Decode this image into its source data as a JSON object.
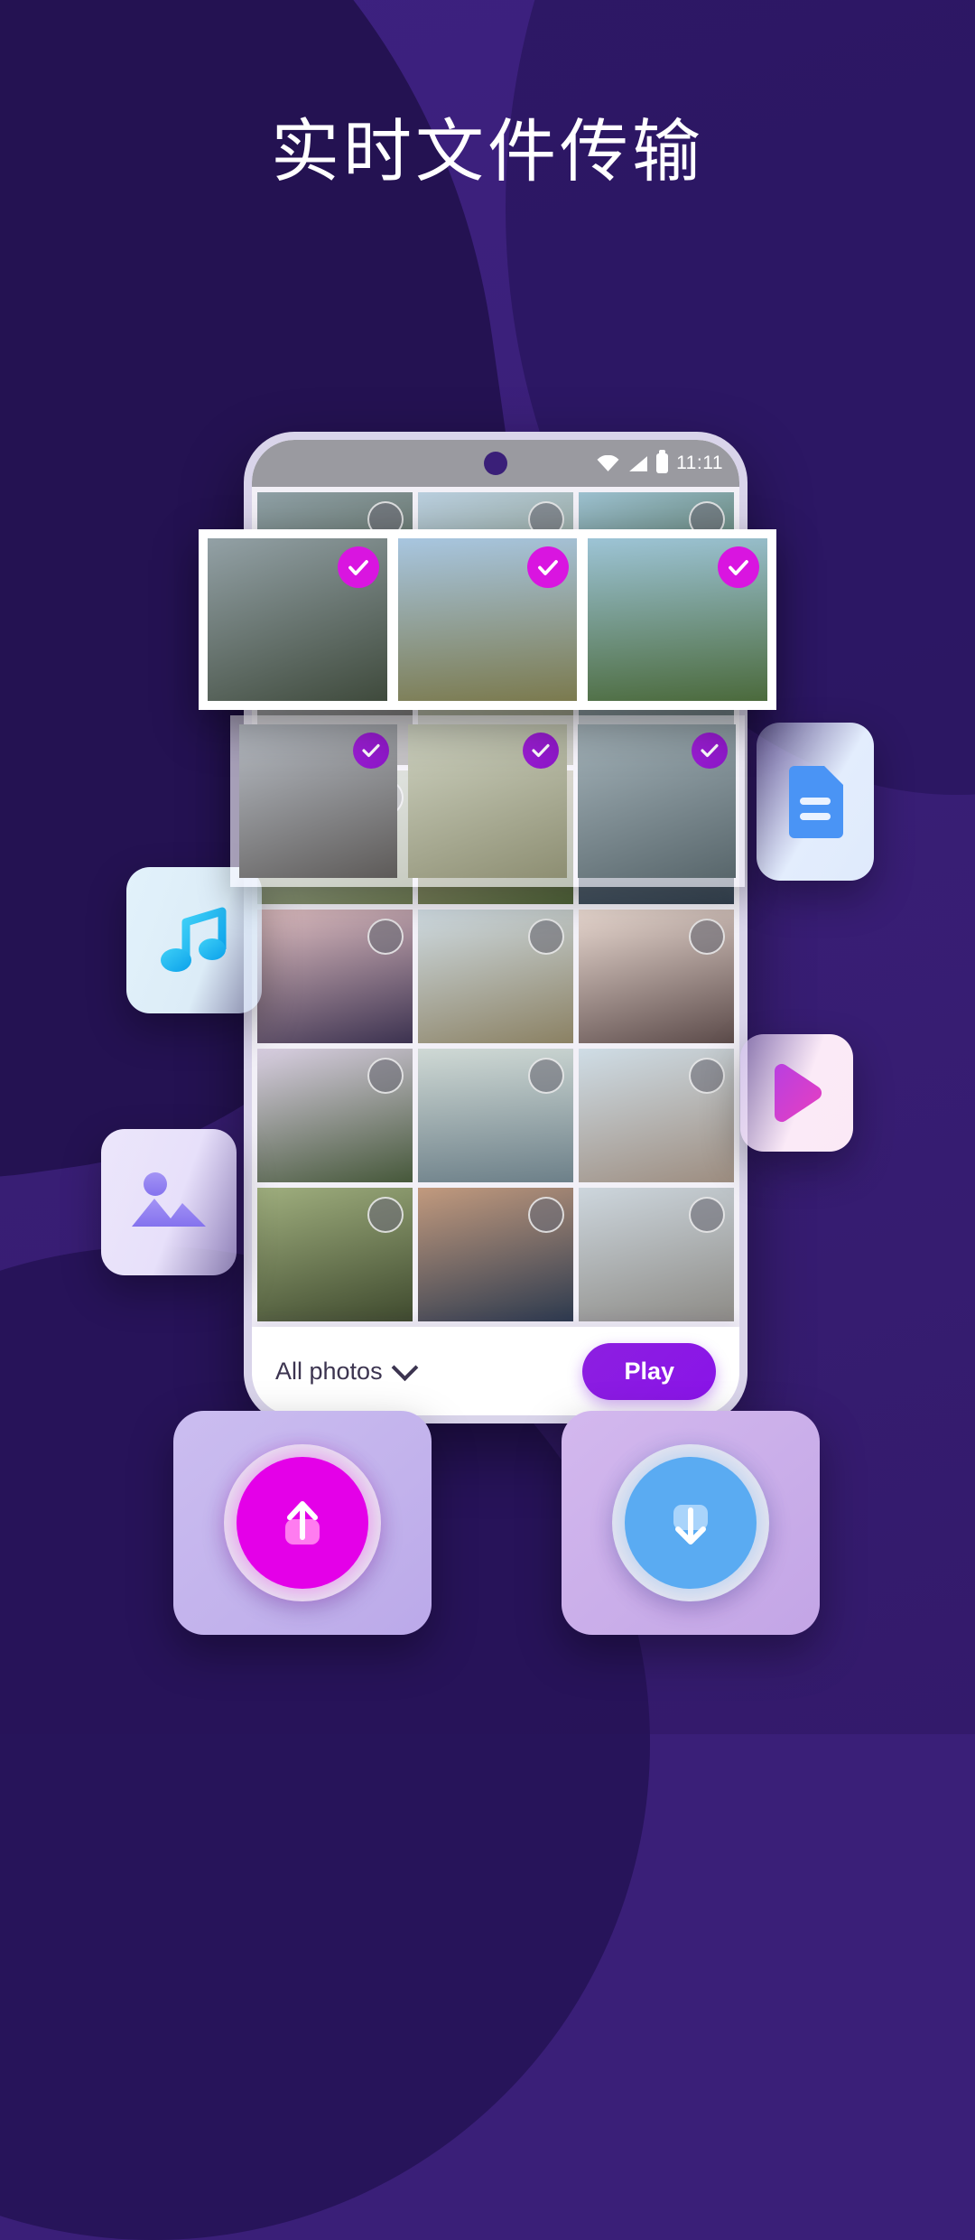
{
  "page": {
    "headline": "实时文件传输",
    "background_color": "#3a1f78",
    "background_shape_color": "#241252"
  },
  "phone": {
    "statusbar": {
      "time": "11:11",
      "wifi_icon": "wifi-icon",
      "signal_icon": "cellular-signal-icon",
      "battery_icon": "battery-icon",
      "camera_icon": "front-camera-icon"
    },
    "bottom_bar": {
      "filter_label": "All photos",
      "filter_chevron_icon": "chevron-down-icon",
      "play_label": "Play",
      "play_color": "#8a14e8"
    }
  },
  "selected_strips": {
    "check_color_primary": "#d915e0",
    "check_color_secondary": "#9a1ad0",
    "check_icon": "check-icon",
    "row1": [
      {
        "alt": "blonde hiker facing mountain valley",
        "selected": true
      },
      {
        "alt": "rock formation under cloudy sky",
        "selected": true
      },
      {
        "alt": "couple sitting on cliff over jungle",
        "selected": true
      }
    ],
    "row2": [
      {
        "alt": "woman walking on city street",
        "selected": true
      },
      {
        "alt": "cactus in desert landscape",
        "selected": true
      },
      {
        "alt": "photographer by mountain lake",
        "selected": true
      }
    ]
  },
  "photo_grid": {
    "unselected_badge_icon": "selection-circle-icon",
    "rows": [
      [
        {
          "alt": "woman laughing on road"
        },
        {
          "alt": "green camper van in forest"
        },
        {
          "alt": "mountain lake at dusk"
        }
      ],
      [
        {
          "alt": "venice gondolas at sunset"
        },
        {
          "alt": "rv camper on coastal cliff"
        },
        {
          "alt": "two women playing guitar on beach"
        }
      ],
      [
        {
          "alt": "castle below snowy alps"
        },
        {
          "alt": "friends jumping into sea"
        },
        {
          "alt": "couple on beach at sunset"
        }
      ],
      [
        {
          "alt": "man with black dog"
        },
        {
          "alt": "mediterranean village at night"
        },
        {
          "alt": "old european town facade"
        }
      ]
    ]
  },
  "file_cards": [
    {
      "name": "document-file-card",
      "icon": "document-icon",
      "color": "#4a94f5"
    },
    {
      "name": "music-file-card",
      "icon": "music-note-icon",
      "color": "#18b6f0"
    },
    {
      "name": "video-file-card",
      "icon": "play-triangle-icon",
      "color": "#d637c8"
    },
    {
      "name": "photo-file-card",
      "icon": "image-icon",
      "color": "#8f7df0"
    }
  ],
  "actions": {
    "send": {
      "name": "send-button",
      "icon": "upload-arrow-icon",
      "color": "#e400e8"
    },
    "receive": {
      "name": "receive-button",
      "icon": "download-arrow-icon",
      "color": "#5aabf2"
    }
  }
}
